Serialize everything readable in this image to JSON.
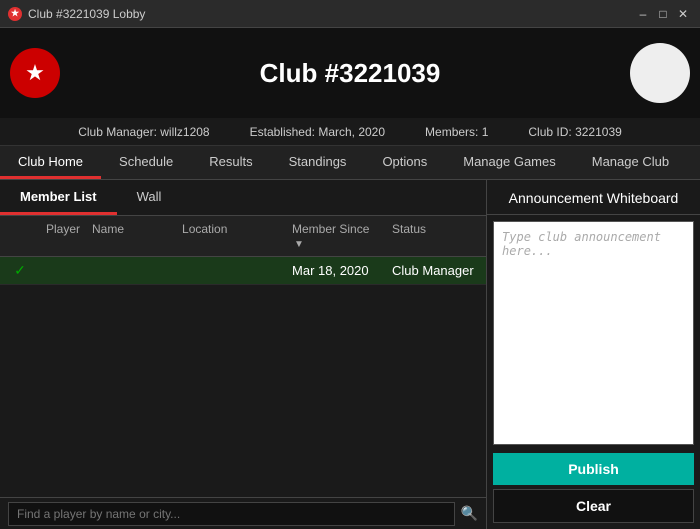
{
  "titlebar": {
    "icon": "★",
    "title": "Club #3221039 Lobby",
    "controls": {
      "minimize": "–",
      "maximize": "□",
      "close": "✕"
    }
  },
  "header": {
    "logo_icon": "★",
    "title": "Club #3221039"
  },
  "infobar": {
    "manager": "Club Manager: willz1208",
    "established": "Established: March, 2020",
    "members": "Members: 1",
    "club_id": "Club ID: 3221039"
  },
  "nav": {
    "tabs": [
      {
        "label": "Club Home",
        "active": true
      },
      {
        "label": "Schedule",
        "active": false
      },
      {
        "label": "Results",
        "active": false
      },
      {
        "label": "Standings",
        "active": false
      },
      {
        "label": "Options",
        "active": false
      },
      {
        "label": "Manage Games",
        "active": false
      },
      {
        "label": "Manage Club",
        "active": false
      }
    ]
  },
  "left_panel": {
    "sub_tabs": [
      {
        "label": "Member List",
        "active": true
      },
      {
        "label": "Wall",
        "active": false
      }
    ],
    "table": {
      "headers": [
        {
          "label": "",
          "key": "col-player"
        },
        {
          "label": "Player",
          "key": "col-name"
        },
        {
          "label": "Name",
          "key": "col-location"
        },
        {
          "label": "Location",
          "key": "col-since"
        },
        {
          "label": "Member Since",
          "key": "col-status",
          "has_arrow": true
        },
        {
          "label": "Status",
          "key": "col-end"
        }
      ],
      "rows": [
        {
          "selected": true,
          "checkmark": "✓",
          "player": "",
          "name": "",
          "location": "",
          "since": "Mar 18, 2020",
          "status": "Club Manager"
        }
      ]
    },
    "search": {
      "placeholder": "Find a player by name or city...",
      "icon": "🔍"
    }
  },
  "right_panel": {
    "title": "Announcement Whiteboard",
    "textarea_placeholder": "Type club announcement here...",
    "publish_label": "Publish",
    "clear_label": "Clear"
  }
}
